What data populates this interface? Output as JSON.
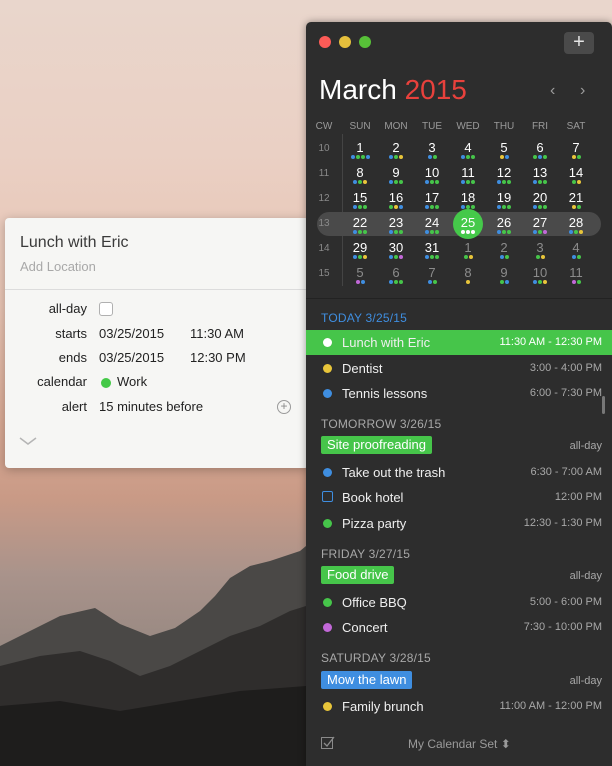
{
  "popover": {
    "title": "Lunch with Eric",
    "location_placeholder": "Add Location",
    "allday_label": "all-day",
    "starts_label": "starts",
    "starts_date": "03/25/2015",
    "starts_time": "11:30 AM",
    "ends_label": "ends",
    "ends_date": "03/25/2015",
    "ends_time": "12:30 PM",
    "calendar_label": "calendar",
    "calendar_value": "Work",
    "alert_label": "alert",
    "alert_value": "15 minutes before"
  },
  "window": {
    "add_label": "+",
    "month": "March",
    "year": "2015",
    "prev_icon": "chevron-left-icon",
    "next_icon": "chevron-right-icon"
  },
  "calendar": {
    "headers": [
      "CW",
      "SUN",
      "MON",
      "TUE",
      "WED",
      "THU",
      "FRI",
      "SAT"
    ],
    "weeks": [
      {
        "cw": "10",
        "days": [
          {
            "d": "1",
            "dots": [
              "#3f8ee0",
              "#46c54a",
              "#46c54a",
              "#3f8ee0"
            ]
          },
          {
            "d": "2",
            "dots": [
              "#3f8ee0",
              "#46c54a",
              "#e8c53a"
            ]
          },
          {
            "d": "3",
            "dots": [
              "#3f8ee0",
              "#46c54a"
            ]
          },
          {
            "d": "4",
            "dots": [
              "#3f8ee0",
              "#46c54a",
              "#46c54a"
            ]
          },
          {
            "d": "5",
            "dots": [
              "#e8c53a",
              "#3f8ee0"
            ]
          },
          {
            "d": "6",
            "dots": [
              "#46c54a",
              "#3f8ee0",
              "#46c54a"
            ]
          },
          {
            "d": "7",
            "dots": [
              "#e8c53a",
              "#46c54a"
            ]
          }
        ]
      },
      {
        "cw": "11",
        "days": [
          {
            "d": "8",
            "dots": [
              "#3f8ee0",
              "#46c54a",
              "#e8c53a"
            ]
          },
          {
            "d": "9",
            "dots": [
              "#3f8ee0",
              "#46c54a",
              "#46c54a"
            ]
          },
          {
            "d": "10",
            "dots": [
              "#3f8ee0",
              "#46c54a",
              "#46c54a"
            ]
          },
          {
            "d": "11",
            "dots": [
              "#3f8ee0",
              "#46c54a",
              "#46c54a"
            ]
          },
          {
            "d": "12",
            "dots": [
              "#3f8ee0",
              "#46c54a",
              "#46c54a"
            ]
          },
          {
            "d": "13",
            "dots": [
              "#3f8ee0",
              "#46c54a",
              "#46c54a"
            ]
          },
          {
            "d": "14",
            "dots": [
              "#46c54a",
              "#e8c53a"
            ]
          }
        ]
      },
      {
        "cw": "12",
        "days": [
          {
            "d": "15",
            "dots": [
              "#3f8ee0",
              "#46c54a",
              "#46c54a"
            ]
          },
          {
            "d": "16",
            "dots": [
              "#46c54a",
              "#e8c53a",
              "#3f8ee0"
            ]
          },
          {
            "d": "17",
            "dots": [
              "#3f8ee0",
              "#46c54a",
              "#46c54a"
            ]
          },
          {
            "d": "18",
            "dots": [
              "#3f8ee0",
              "#46c54a",
              "#46c54a"
            ]
          },
          {
            "d": "19",
            "dots": [
              "#3f8ee0",
              "#46c54a",
              "#46c54a"
            ]
          },
          {
            "d": "20",
            "dots": [
              "#3f8ee0",
              "#46c54a",
              "#46c54a"
            ]
          },
          {
            "d": "21",
            "dots": [
              "#e8c53a",
              "#46c54a"
            ]
          }
        ]
      },
      {
        "cw": "13",
        "current": true,
        "days": [
          {
            "d": "22",
            "dots": [
              "#3f8ee0",
              "#46c54a",
              "#46c54a"
            ]
          },
          {
            "d": "23",
            "dots": [
              "#3f8ee0",
              "#46c54a",
              "#46c54a"
            ]
          },
          {
            "d": "24",
            "dots": [
              "#3f8ee0",
              "#46c54a",
              "#46c54a"
            ]
          },
          {
            "d": "25",
            "today": true,
            "dots": [
              "#ffffff",
              "#ffffff",
              "#ffffff"
            ]
          },
          {
            "d": "26",
            "dots": [
              "#3f8ee0",
              "#46c54a",
              "#46c54a"
            ]
          },
          {
            "d": "27",
            "dots": [
              "#3f8ee0",
              "#46c54a",
              "#c268d8"
            ]
          },
          {
            "d": "28",
            "dots": [
              "#3f8ee0",
              "#46c54a",
              "#e8c53a"
            ]
          }
        ]
      },
      {
        "cw": "14",
        "days": [
          {
            "d": "29",
            "dots": [
              "#3f8ee0",
              "#46c54a",
              "#e8c53a"
            ]
          },
          {
            "d": "30",
            "dots": [
              "#3f8ee0",
              "#46c54a",
              "#c268d8"
            ]
          },
          {
            "d": "31",
            "dots": [
              "#3f8ee0",
              "#46c54a",
              "#46c54a"
            ]
          },
          {
            "d": "1",
            "dim": true,
            "dots": [
              "#46c54a",
              "#e8c53a"
            ]
          },
          {
            "d": "2",
            "dim": true,
            "dots": [
              "#3f8ee0",
              "#46c54a"
            ]
          },
          {
            "d": "3",
            "dim": true,
            "dots": [
              "#46c54a",
              "#e8c53a"
            ]
          },
          {
            "d": "4",
            "dim": true,
            "dots": [
              "#3f8ee0",
              "#46c54a"
            ]
          }
        ]
      },
      {
        "cw": "15",
        "days": [
          {
            "d": "5",
            "dim": true,
            "dots": [
              "#c268d8",
              "#3f8ee0"
            ]
          },
          {
            "d": "6",
            "dim": true,
            "dots": [
              "#3f8ee0",
              "#46c54a",
              "#46c54a"
            ]
          },
          {
            "d": "7",
            "dim": true,
            "dots": [
              "#3f8ee0",
              "#46c54a"
            ]
          },
          {
            "d": "8",
            "dim": true,
            "dots": [
              "#e8c53a"
            ]
          },
          {
            "d": "9",
            "dim": true,
            "dots": [
              "#46c54a",
              "#3f8ee0"
            ]
          },
          {
            "d": "10",
            "dim": true,
            "dots": [
              "#3f8ee0",
              "#46c54a",
              "#e8c53a"
            ]
          },
          {
            "d": "11",
            "dim": true,
            "dots": [
              "#c268d8",
              "#46c54a"
            ]
          }
        ]
      }
    ]
  },
  "agenda": {
    "today_header": "TODAY 3/25/15",
    "tomorrow_header": "TOMORROW 3/26/15",
    "friday_header": "FRIDAY 3/27/15",
    "saturday_header": "SATURDAY 3/28/15",
    "lunch": {
      "name": "Lunch with Eric",
      "time": "11:30 AM - 12:30 PM"
    },
    "dentist": {
      "name": "Dentist",
      "time": "3:00 - 4:00 PM",
      "color": "#e8c53a"
    },
    "tennis": {
      "name": "Tennis lessons",
      "time": "6:00 - 7:30 PM",
      "color": "#3f8ee0"
    },
    "site": {
      "name": "Site proofreading",
      "time": "all-day",
      "color": "#46c54a"
    },
    "trash": {
      "name": "Take out the trash",
      "time": "6:30 - 7:00 AM",
      "color": "#3f8ee0"
    },
    "hotel": {
      "name": "Book hotel",
      "time": "12:00 PM"
    },
    "pizza": {
      "name": "Pizza party",
      "time": "12:30 - 1:30 PM",
      "color": "#46c54a"
    },
    "food": {
      "name": "Food drive",
      "time": "all-day",
      "color": "#46c54a"
    },
    "bbq": {
      "name": "Office BBQ",
      "time": "5:00 - 6:00 PM",
      "color": "#46c54a"
    },
    "concert": {
      "name": "Concert",
      "time": "7:30 - 10:00 PM",
      "color": "#c268d8"
    },
    "lawn": {
      "name": "Mow the lawn",
      "time": "all-day",
      "color": "#3f8ee0"
    },
    "brunch": {
      "name": "Family brunch",
      "time": "11:00 AM - 12:00 PM",
      "color": "#e8c53a"
    }
  },
  "footer": {
    "calendar_set": "My Calendar Set ⬍"
  }
}
